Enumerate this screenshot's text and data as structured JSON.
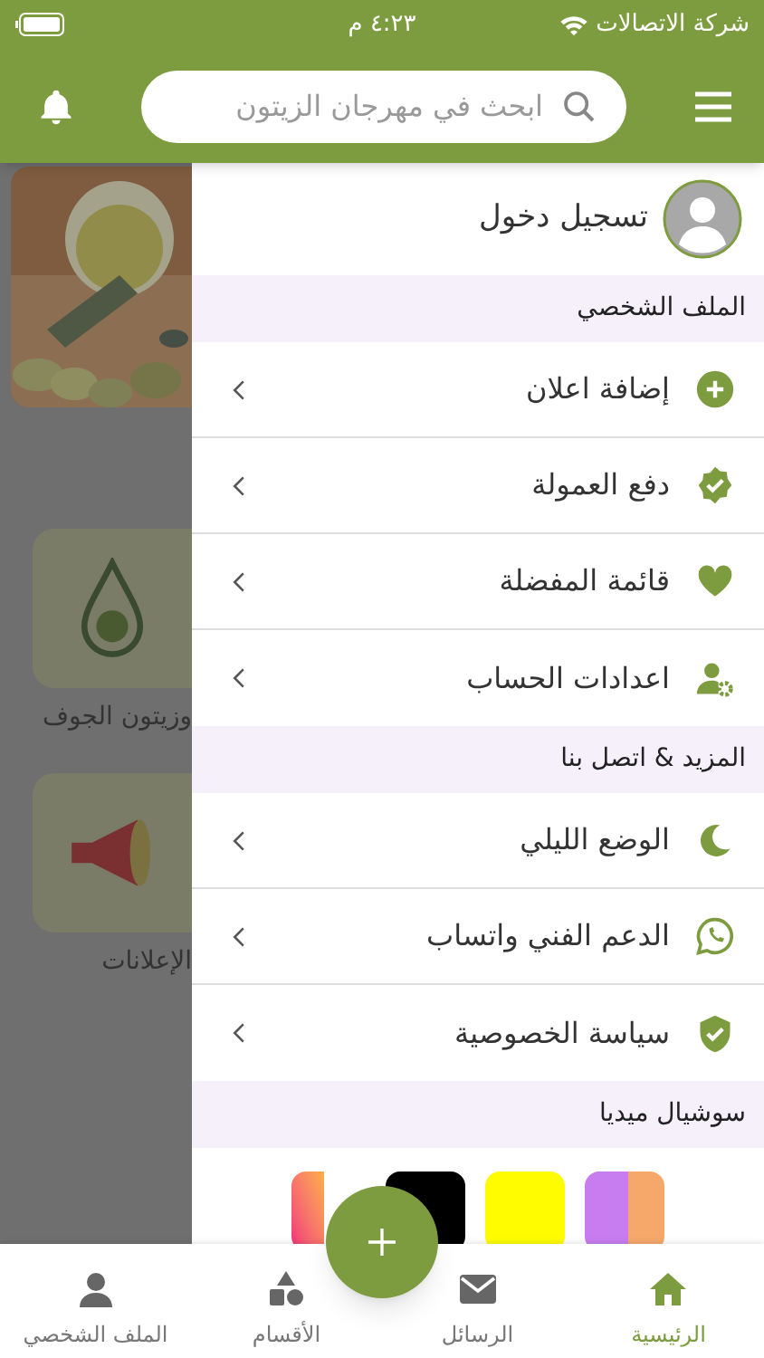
{
  "status_bar": {
    "carrier": "شركة الاتصالات",
    "time": "٤:٢٣ م"
  },
  "header": {
    "search": {
      "placeholder": "ابحث في مهرجان الزيتون"
    }
  },
  "background": {
    "categories": [
      {
        "label": "وزيتون الجوف"
      },
      {
        "label": "الإعلانات"
      }
    ]
  },
  "drawer": {
    "login": "تسجيل دخول",
    "sections": [
      {
        "title": "الملف الشخصي",
        "items": [
          {
            "label": "إضافة اعلان"
          },
          {
            "label": "دفع العمولة"
          },
          {
            "label": "قائمة المفضلة"
          },
          {
            "label": "اعدادات الحساب"
          }
        ]
      },
      {
        "title": "المزيد & اتصل بنا",
        "items": [
          {
            "label": "الوضع الليلي"
          },
          {
            "label": "الدعم الفني واتساب"
          },
          {
            "label": "سياسة الخصوصية"
          }
        ]
      },
      {
        "title": "سوشيال ميديا"
      }
    ]
  },
  "bottom_nav": [
    {
      "label": "الرئيسية",
      "selected": true
    },
    {
      "label": "الرسائل",
      "selected": false
    },
    {
      "label": "الأقسام",
      "selected": false
    },
    {
      "label": "الملف الشخصي",
      "selected": false
    }
  ]
}
